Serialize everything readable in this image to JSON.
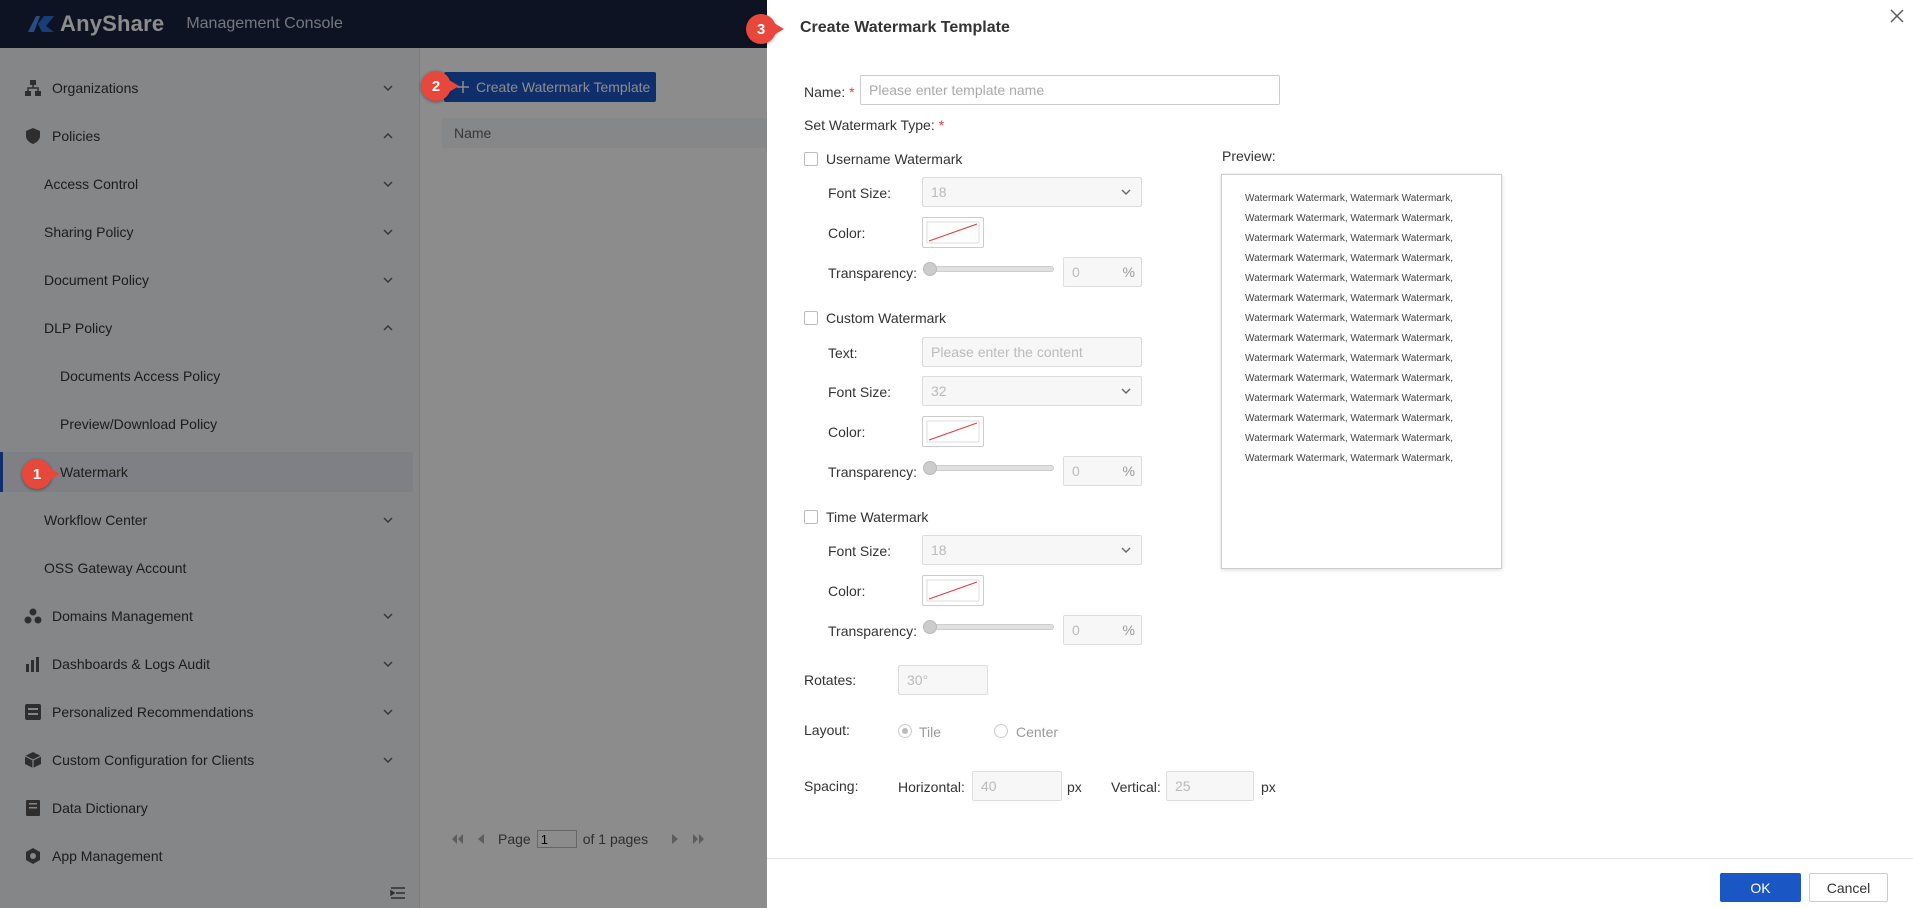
{
  "app": {
    "brand": "AnyShare",
    "console_title": "Management Console"
  },
  "sidebar": {
    "items": [
      {
        "label": "Organizations",
        "icon": "org-tree-icon"
      },
      {
        "label": "Policies",
        "icon": "shield-icon"
      },
      {
        "label": "Access Control"
      },
      {
        "label": "Sharing Policy"
      },
      {
        "label": "Document Policy"
      },
      {
        "label": "DLP Policy"
      },
      {
        "label": "Documents Access Policy"
      },
      {
        "label": "Preview/Download Policy"
      },
      {
        "label": "Watermark"
      },
      {
        "label": "Workflow Center"
      },
      {
        "label": "OSS Gateway Account"
      },
      {
        "label": "Domains Management",
        "icon": "users-icon"
      },
      {
        "label": "Dashboards & Logs Audit",
        "icon": "bar-chart-icon"
      },
      {
        "label": "Personalized Recommendations",
        "icon": "list-icon"
      },
      {
        "label": "Custom Configuration for Clients",
        "icon": "box-icon"
      },
      {
        "label": "Data Dictionary",
        "icon": "book-icon"
      },
      {
        "label": "App Management",
        "icon": "hexagon-icon"
      }
    ],
    "active": "Watermark"
  },
  "main": {
    "create_button": "Create Watermark Template",
    "column_name": "Name",
    "pager": {
      "page_label": "Page",
      "page_value": "1",
      "of_label": "of 1 pages"
    }
  },
  "badges": {
    "one": "1",
    "two": "2",
    "three": "3"
  },
  "dialog": {
    "title": "Create Watermark Template",
    "name_label": "Name:",
    "name_placeholder": "Please enter template name",
    "type_label": "Set Watermark Type:",
    "required_mark": "*",
    "preview_label": "Preview:",
    "username": {
      "label": "Username Watermark",
      "font_size_label": "Font Size:",
      "font_size": "18",
      "color_label": "Color:",
      "transparency_label": "Transparency:",
      "transparency": "0",
      "unit": "%"
    },
    "custom": {
      "label": "Custom Watermark",
      "text_label": "Text:",
      "text_placeholder": "Please enter the content",
      "font_size_label": "Font Size:",
      "font_size": "32",
      "color_label": "Color:",
      "transparency_label": "Transparency:",
      "transparency": "0",
      "unit": "%"
    },
    "time": {
      "label": "Time Watermark",
      "font_size_label": "Font Size:",
      "font_size": "18",
      "color_label": "Color:",
      "transparency_label": "Transparency:",
      "transparency": "0",
      "unit": "%"
    },
    "rotates_label": "Rotates:",
    "rotates": "30°",
    "layout_label": "Layout:",
    "layout_tile": "Tile",
    "layout_center": "Center",
    "spacing_label": "Spacing:",
    "horizontal_label": "Horizontal:",
    "horizontal": "40",
    "vertical_label": "Vertical:",
    "vertical": "25",
    "px": "px",
    "preview_line": "Watermark Watermark, Watermark Watermark,",
    "ok": "OK",
    "cancel": "Cancel"
  }
}
